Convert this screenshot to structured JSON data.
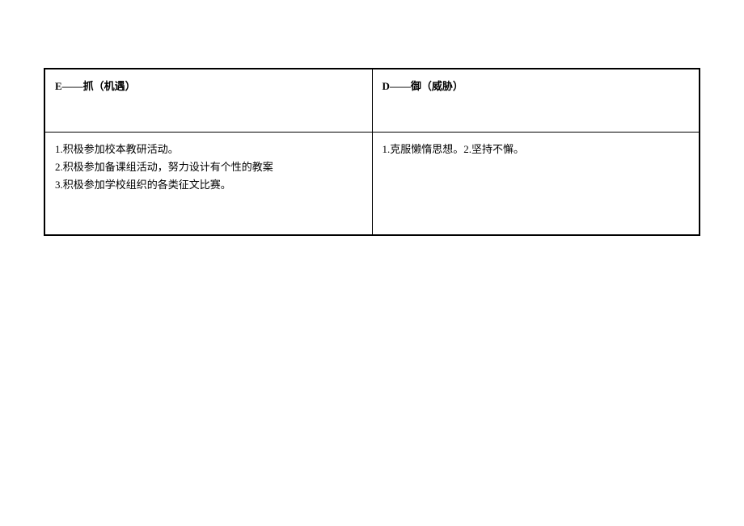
{
  "table": {
    "headers": {
      "left": "E——抓（机遇）",
      "right": "D——御（威胁）"
    },
    "content": {
      "left_lines": [
        "1.积极参加校本教研活动。",
        "2.积极参加备课组活动，努力设计有个性的教案",
        "3.积极参加学校组织的各类征文比赛。"
      ],
      "right": "1.克服懒惰思想。2.坚持不懈。"
    }
  }
}
